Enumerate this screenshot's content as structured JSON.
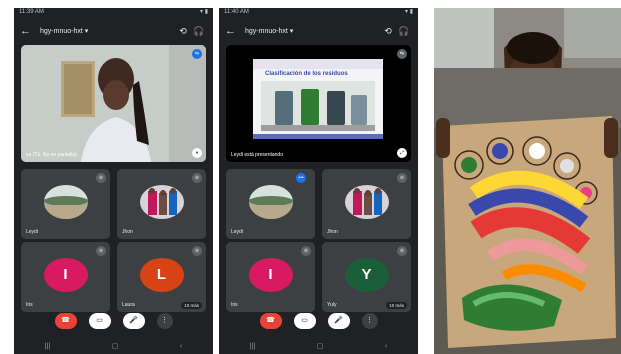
{
  "phone1": {
    "status_time": "11:39 AM",
    "status_icons": "▾ ▮",
    "meeting_name": "hgy-mnuo-hxt ▾",
    "main_tile_name": "ya (Tú, fijo en pantalla)",
    "tiles": [
      {
        "name": "Leydi",
        "kind": "avatar"
      },
      {
        "name": "Jhon",
        "kind": "avatar"
      },
      {
        "name": "Iris",
        "kind": "letter",
        "letter": "I",
        "color": "#d81b60"
      },
      {
        "name": "Laura",
        "kind": "letter",
        "letter": "L",
        "color": "#d84315",
        "more": "10 más"
      }
    ]
  },
  "phone2": {
    "status_time": "11:40 AM",
    "status_icons": "▾ ▮",
    "meeting_name": "hgy-mnuo-hxt ▾",
    "presentation_title": "Clasificación de los residuos",
    "main_tile_name": "Leydi está presentando",
    "tiles": [
      {
        "name": "Leydi",
        "kind": "avatar",
        "mic_on": true
      },
      {
        "name": "Jhon",
        "kind": "avatar"
      },
      {
        "name": "Iris",
        "kind": "letter",
        "letter": "I",
        "color": "#d81b60"
      },
      {
        "name": "Yuly",
        "kind": "letter",
        "letter": "Y",
        "color": "#1b5e3a",
        "more": "10 más"
      }
    ]
  },
  "icons": {
    "back": "←",
    "switch_camera": "⟲",
    "audio": "🎧",
    "end_call": "☎",
    "camera": "▭",
    "mic": "🎤",
    "more": "⋮",
    "nav_recent": "|||",
    "nav_home": "▢",
    "nav_back": "‹"
  },
  "colors": {
    "meet_bg": "#202124",
    "tile_bg": "#3c4043",
    "end_call": "#ea4335"
  }
}
